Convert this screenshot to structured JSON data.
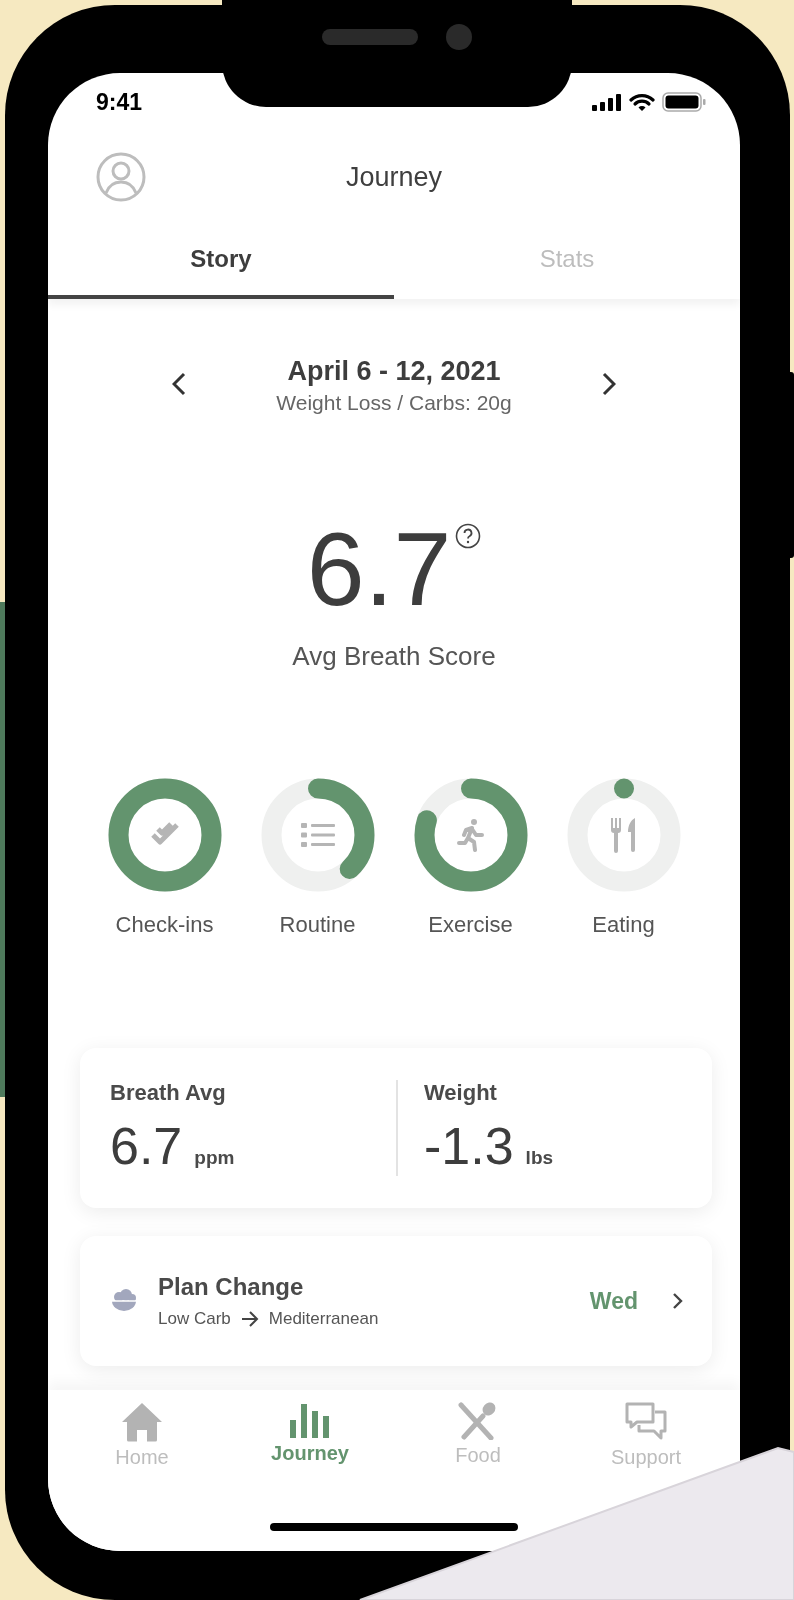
{
  "status_bar": {
    "time": "9:41"
  },
  "header": {
    "title": "Journey"
  },
  "tabs": [
    {
      "label": "Story",
      "selected": true
    },
    {
      "label": "Stats",
      "selected": false
    }
  ],
  "week": {
    "range": "April 6 - 12, 2021",
    "plan": "Weight Loss / Carbs: 20g"
  },
  "score": {
    "value": "6.7",
    "label": "Avg Breath Score"
  },
  "rings": [
    {
      "kind": "checkins",
      "label": "Check-ins",
      "level": 1
    },
    {
      "kind": "routine",
      "label": "Routine",
      "level": 0.38
    },
    {
      "kind": "exercise",
      "label": "Exercise",
      "level": 0.8
    },
    {
      "kind": "eating",
      "label": "Eating",
      "level": 0
    }
  ],
  "stats": [
    {
      "label": "Breath Avg",
      "value": "6.7",
      "unit": "ppm"
    },
    {
      "label": "Weight",
      "value": "-1.3",
      "unit": "lbs"
    }
  ],
  "plan_change": {
    "title": "Plan Change",
    "from": "Low Carb",
    "to": "Mediterranean",
    "day": "Wed"
  },
  "nav": [
    {
      "kind": "home",
      "label": "Home",
      "selected": false
    },
    {
      "kind": "journey",
      "label": "Journey",
      "selected": true
    },
    {
      "kind": "food",
      "label": "Food",
      "selected": false
    },
    {
      "kind": "support",
      "label": "Support",
      "selected": false
    }
  ]
}
